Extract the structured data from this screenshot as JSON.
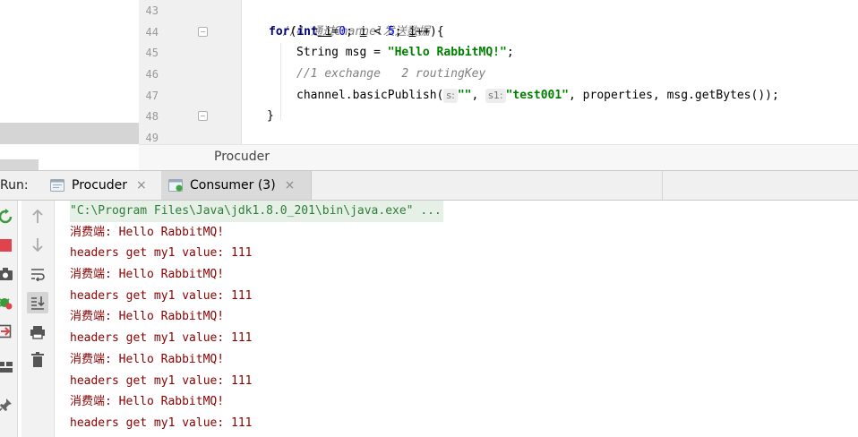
{
  "editor": {
    "line_numbers": [
      "43",
      "44",
      "45",
      "46",
      "47",
      "48",
      "49"
    ],
    "lines": {
      "l43_comment": "//4 通过Channel发送数据",
      "l44_for": "for",
      "l44_open": "(",
      "l44_int": "int",
      "l44_i_decl": " i",
      "l44_eq": "=",
      "l44_zero": "0",
      "l44_sep1": "; ",
      "l44_i_cmp": "i",
      "l44_lt": " < ",
      "l44_five": "5",
      "l44_sep2": "; ",
      "l44_i_inc": "i",
      "l44_tail": "++){",
      "l45_type": "String msg = ",
      "l45_str": "\"Hello RabbitMQ!\"",
      "l45_end": ";",
      "l46_comment": "//1 exchange   2 routingKey",
      "l47_call": "channel.basicPublish(",
      "l47_hint1": "s:",
      "l47_str1": "\"\"",
      "l47_comma": ", ",
      "l47_hint2": "s1:",
      "l47_str2": "\"test001\"",
      "l47_rest": ", properties, msg.getBytes());",
      "l48_close": "}"
    },
    "breadcrumb": "Procuder"
  },
  "run": {
    "label": "Run:",
    "tabs": [
      {
        "label": "Procuder",
        "close": "×"
      },
      {
        "label": "Consumer (3)",
        "close": "×"
      }
    ]
  },
  "console": {
    "lines": [
      "\"C:\\Program Files\\Java\\jdk1.8.0_201\\bin\\java.exe\" ...",
      "消费端: Hello RabbitMQ!",
      "headers get my1 value: 111",
      "消费端: Hello RabbitMQ!",
      "headers get my1 value: 111",
      "消费端: Hello RabbitMQ!",
      "headers get my1 value: 111",
      "消费端: Hello RabbitMQ!",
      "headers get my1 value: 111",
      "消费端: Hello RabbitMQ!",
      "headers get my1 value: 111"
    ]
  },
  "colors": {
    "command": "#2f7d3b",
    "output": "#8b0000",
    "keyword": "#000080",
    "string": "#008000",
    "comment": "#808080",
    "number": "#0000ff"
  },
  "icons": {
    "left_toolbar": [
      "rerun-icon",
      "stop-icon",
      "camera-icon",
      "debug-restore-icon",
      "exit-icon",
      "layout-icon",
      "pin-icon"
    ],
    "right_toolbar": [
      "arrow-up-icon",
      "arrow-down-icon",
      "soft-wrap-icon",
      "scroll-to-end-icon",
      "print-icon",
      "trash-icon"
    ]
  }
}
